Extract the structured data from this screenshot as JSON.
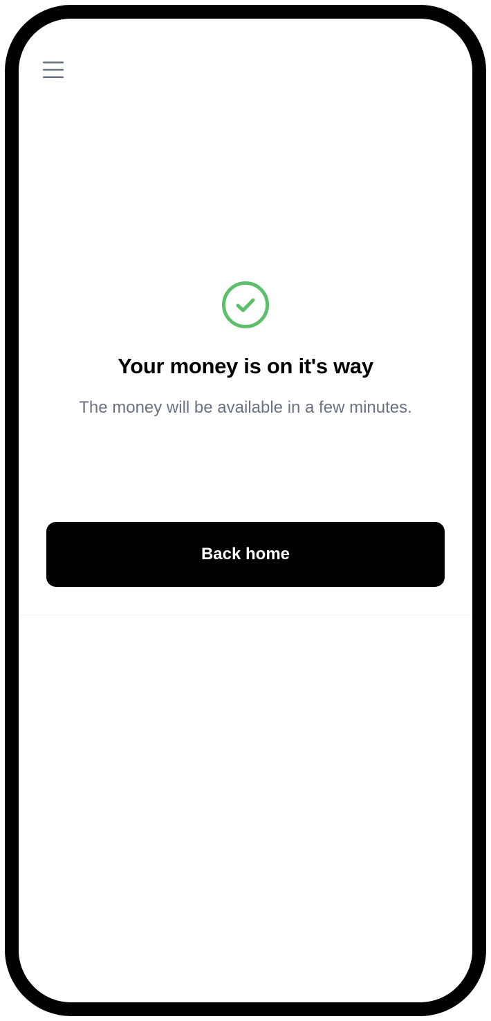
{
  "icons": {
    "menu": "hamburger-menu-icon",
    "status": "check-circle-icon"
  },
  "colors": {
    "success": "#5cbf6a",
    "menu_icon": "#6b7280",
    "button_background": "#000000",
    "button_text": "#ffffff",
    "subtitle_text": "#6b7280"
  },
  "confirmation": {
    "title": "Your money is on it's way",
    "subtitle": "The money will be available in a few minutes."
  },
  "actions": {
    "back_home_label": "Back home"
  }
}
